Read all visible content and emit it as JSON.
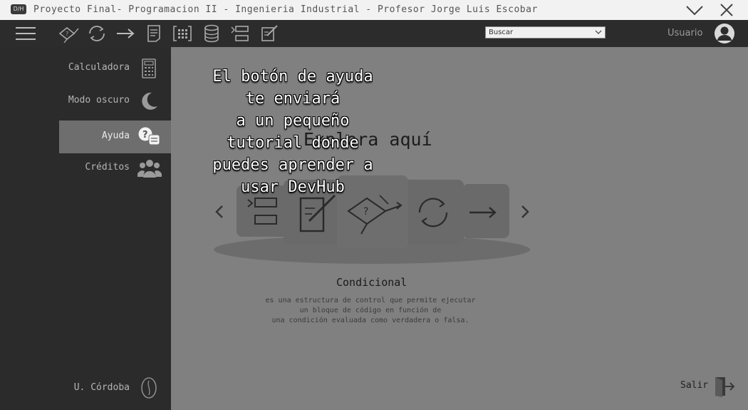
{
  "window": {
    "title": "Proyecto Final- Programacion II - Ingenieria Industrial - Profesor Jorge Luis Escobar",
    "app_icon_text": "D/H"
  },
  "toolbar": {
    "icons": [
      "hamburger-menu-icon",
      "conditional-icon",
      "loop-icon",
      "arrow-icon",
      "document-icon",
      "array-icon",
      "database-icon",
      "list-icon",
      "edit-icon"
    ],
    "search_selected": "Buscar",
    "user_label": "Usuario"
  },
  "sidebar": {
    "items": [
      {
        "label": "Calculadora",
        "icon": "calculator-icon"
      },
      {
        "label": "Modo oscuro",
        "icon": "moon-icon"
      },
      {
        "label": "Ayuda",
        "icon": "help-chat-icon",
        "active": true
      },
      {
        "label": "Créditos",
        "icon": "people-icon"
      }
    ],
    "footer_label": "U. Córdoba"
  },
  "main": {
    "heading": "Explora aquí",
    "selected_concept": "Condicional",
    "description": [
      "es una estructura de control que permite ejecutar",
      "un bloque de código en función de",
      "una condición evaluada como verdadera o falsa."
    ],
    "exit_label": "Salir"
  },
  "tooltip": {
    "lines": [
      "El botón de ayuda",
      "te enviará",
      "a un pequeño",
      "tutorial donde",
      "puedes aprender a",
      "usar DevHub"
    ]
  },
  "colors": {
    "toolbar_bg": "#2c2c2c",
    "sidebar_bg": "#2b2b2b",
    "main_bg": "#808080",
    "active_item_bg": "#6e6e6e"
  }
}
